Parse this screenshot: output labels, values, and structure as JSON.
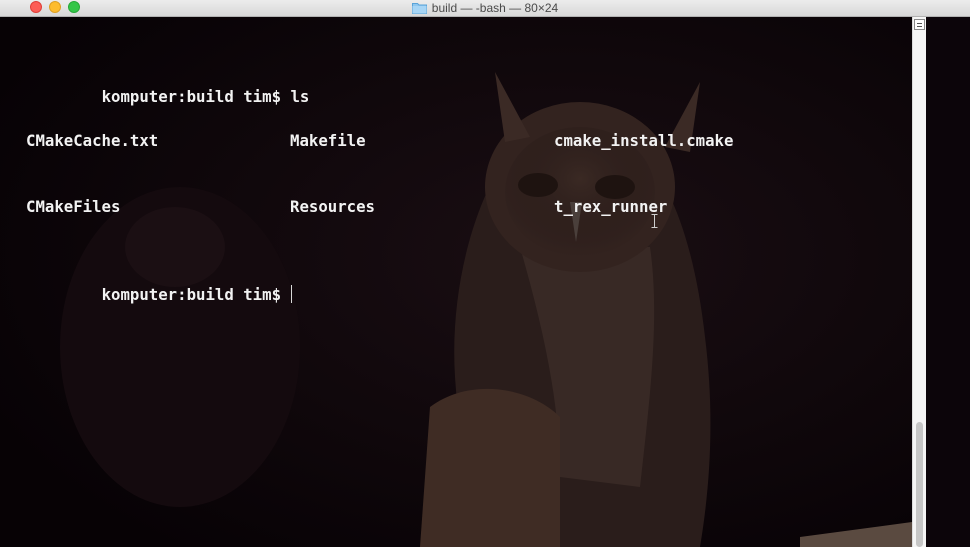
{
  "window": {
    "title": "build — -bash — 80×24",
    "title_icon": "folder-icon"
  },
  "terminal": {
    "prompt_1": "komputer:build tim$ ls",
    "ls_row_1": [
      "CMakeCache.txt",
      "Makefile",
      "cmake_install.cmake"
    ],
    "ls_row_2": [
      "CMakeFiles",
      "Resources",
      "t_rex_runner"
    ],
    "prompt_2": "komputer:build tim$",
    "background": "owl photo",
    "colors": {
      "text": "#f2f2f2",
      "background": "#0b0408"
    }
  }
}
